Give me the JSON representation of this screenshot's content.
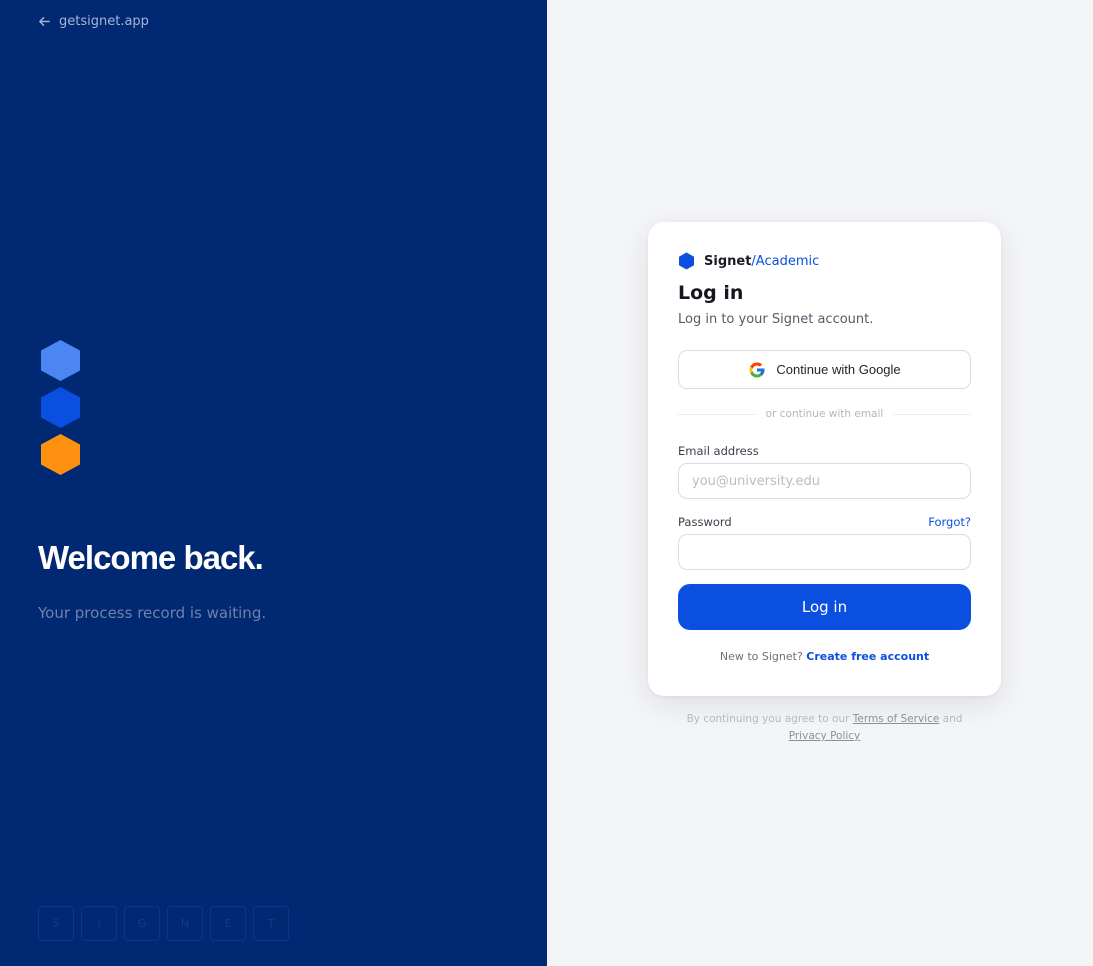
{
  "left_panel": {
    "back_link": "getsignet.app",
    "heading": "Welcome back.",
    "tagline": "Your process record is waiting.",
    "tiles": [
      "S",
      "I",
      "G",
      "N",
      "E",
      "T"
    ],
    "hex_colors": [
      "#4b86f3",
      "#0b4fe0",
      "#ff9110"
    ]
  },
  "card": {
    "brand_name": "Signet",
    "brand_suffix": "/Academic",
    "title": "Log in",
    "subtitle": "Log in to your Signet account.",
    "google_button": "Continue with Google",
    "divider_text": "or continue with email",
    "email_label": "Email address",
    "email_placeholder": "you@university.edu",
    "email_value": "",
    "password_label": "Password",
    "password_value": "",
    "forgot_link": "Forgot?",
    "login_button": "Log in",
    "signup_prompt": "New to Signet?",
    "signup_link": "Create free account"
  },
  "legal": {
    "prefix": "By continuing you agree to our",
    "terms": "Terms of Service",
    "and": "and",
    "privacy": "Privacy Policy"
  },
  "colors": {
    "left_bg": "#012873",
    "accent": "#0b4fe0",
    "page_bg": "#f4f5f7"
  }
}
